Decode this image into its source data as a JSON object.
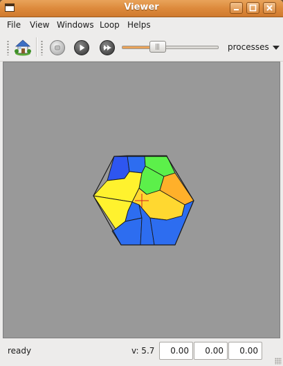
{
  "window": {
    "title": "Viewer",
    "controls": [
      "minimize-icon",
      "maximize-icon",
      "close-icon"
    ]
  },
  "menu": {
    "items": [
      "File",
      "View",
      "Windows",
      "Loop",
      "Helps"
    ]
  },
  "toolbar": {
    "home_icon": "home-icon",
    "stop_icon": "stop-icon",
    "play_icon": "play-icon",
    "step_icon": "step-icon",
    "slider_level": 0.37,
    "combo_value": "processes"
  },
  "viewport": {
    "background": "#999999",
    "cell_colors": [
      "#2d6df0",
      "#5cf04a",
      "#fff22e",
      "#ffb02a",
      "#ffd830"
    ]
  },
  "status": {
    "text": "ready",
    "version": "v: 5.7",
    "coords": [
      "0.00",
      "0.00",
      "0.00"
    ]
  }
}
